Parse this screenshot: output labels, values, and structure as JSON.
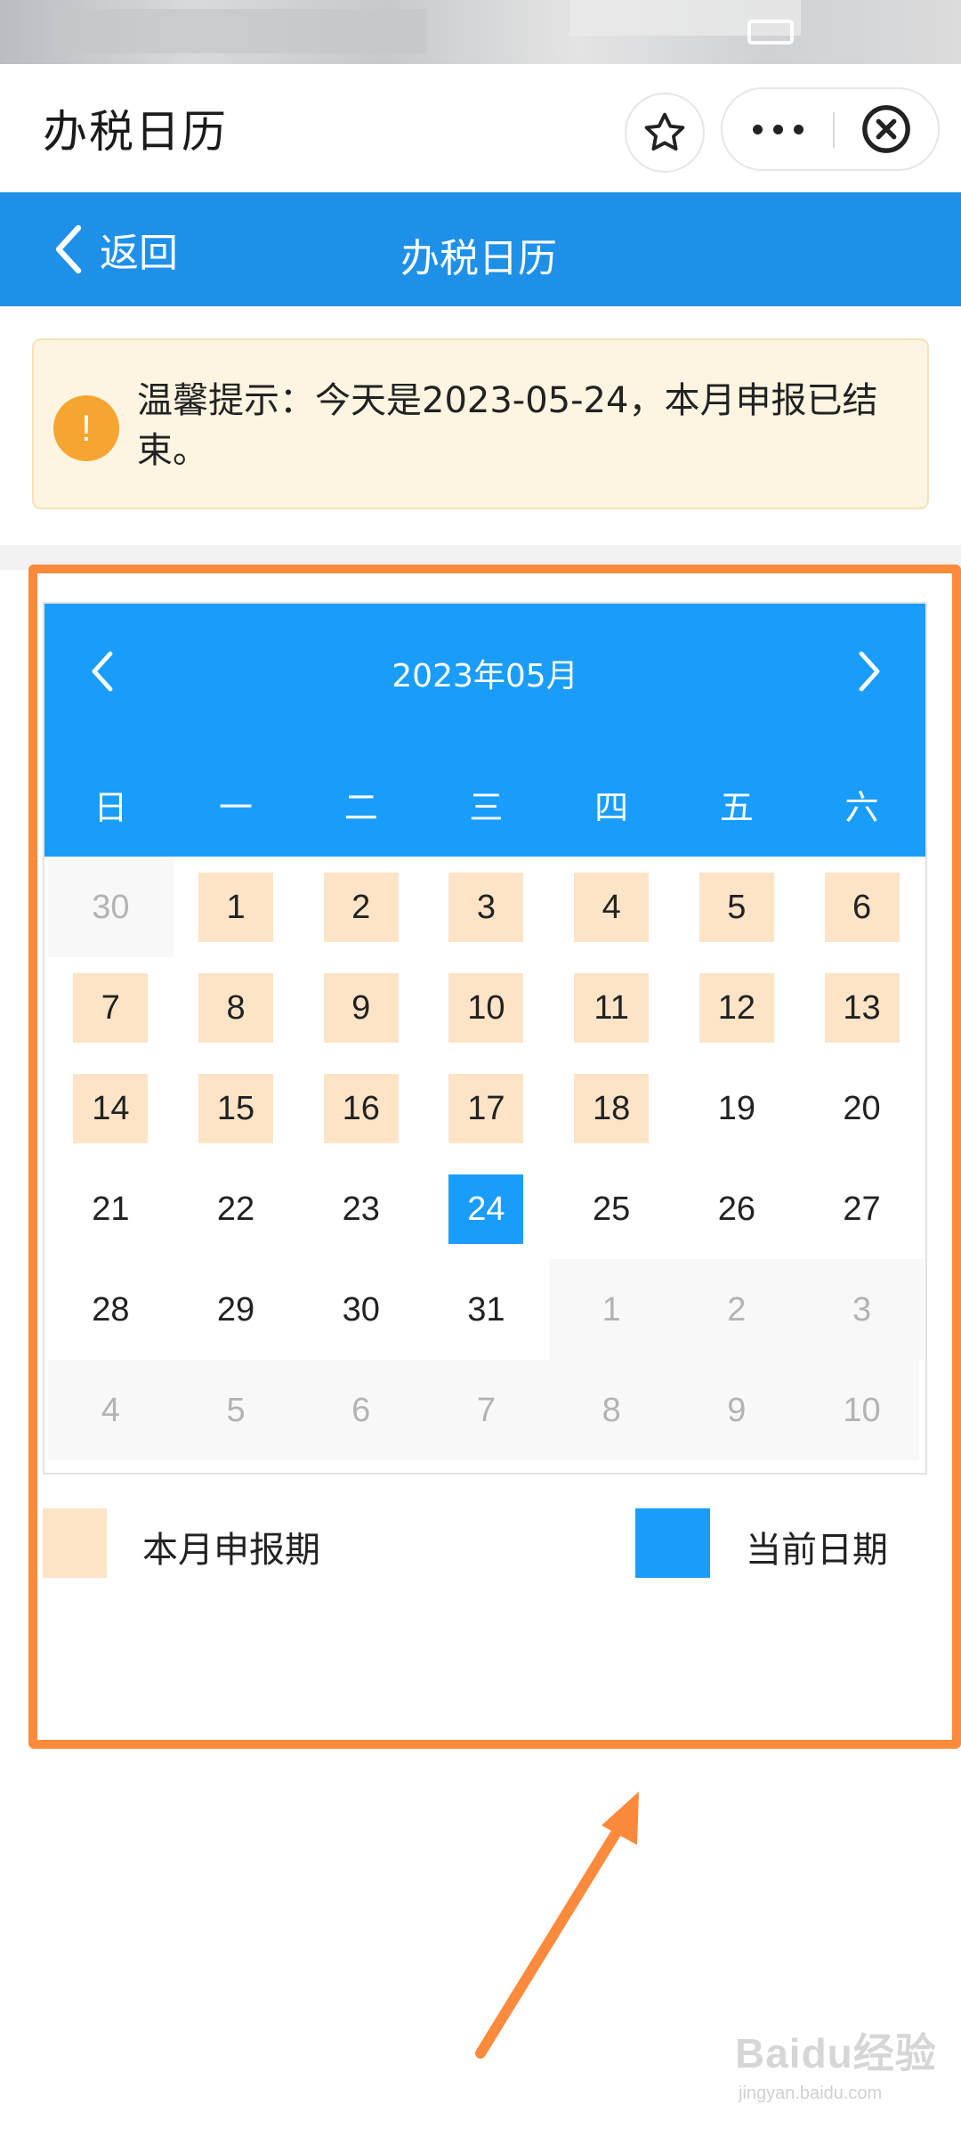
{
  "title_bar": {
    "title": "办税日历"
  },
  "nav": {
    "back_label": "返回",
    "title": "办税日历"
  },
  "notice": {
    "text": "温馨提示：今天是2023-05-24，本月申报已结束。"
  },
  "calendar": {
    "month_label": "2023年05月",
    "weekdays": [
      "日",
      "一",
      "二",
      "三",
      "四",
      "五",
      "六"
    ],
    "weeks": [
      [
        "30",
        "1",
        "2",
        "3",
        "4",
        "5",
        "6"
      ],
      [
        "7",
        "8",
        "9",
        "10",
        "11",
        "12",
        "13"
      ],
      [
        "14",
        "15",
        "16",
        "17",
        "18",
        "19",
        "20"
      ],
      [
        "21",
        "22",
        "23",
        "24",
        "25",
        "26",
        "27"
      ],
      [
        "28",
        "29",
        "30",
        "31",
        "1",
        "2",
        "3"
      ],
      [
        "4",
        "5",
        "6",
        "7",
        "8",
        "9",
        "10"
      ]
    ],
    "filing_period_days": [
      "1",
      "2",
      "3",
      "4",
      "5",
      "6",
      "7",
      "8",
      "9",
      "10",
      "11",
      "12",
      "13",
      "14",
      "15",
      "16",
      "17",
      "18"
    ],
    "current_day": "24"
  },
  "legend": {
    "filing_label": "本月申报期",
    "current_label": "当前日期"
  },
  "watermark": {
    "main": "Baidu经验",
    "sub": "jingyan.baidu.com"
  },
  "colors": {
    "nav_blue": "#1e90e8",
    "calendar_blue": "#1a9dfa",
    "filing_peach": "#fde4c7",
    "notice_bg": "#fdf5e2",
    "warn_orange": "#f7a531",
    "highlight_orange": "#fb8a3c"
  }
}
